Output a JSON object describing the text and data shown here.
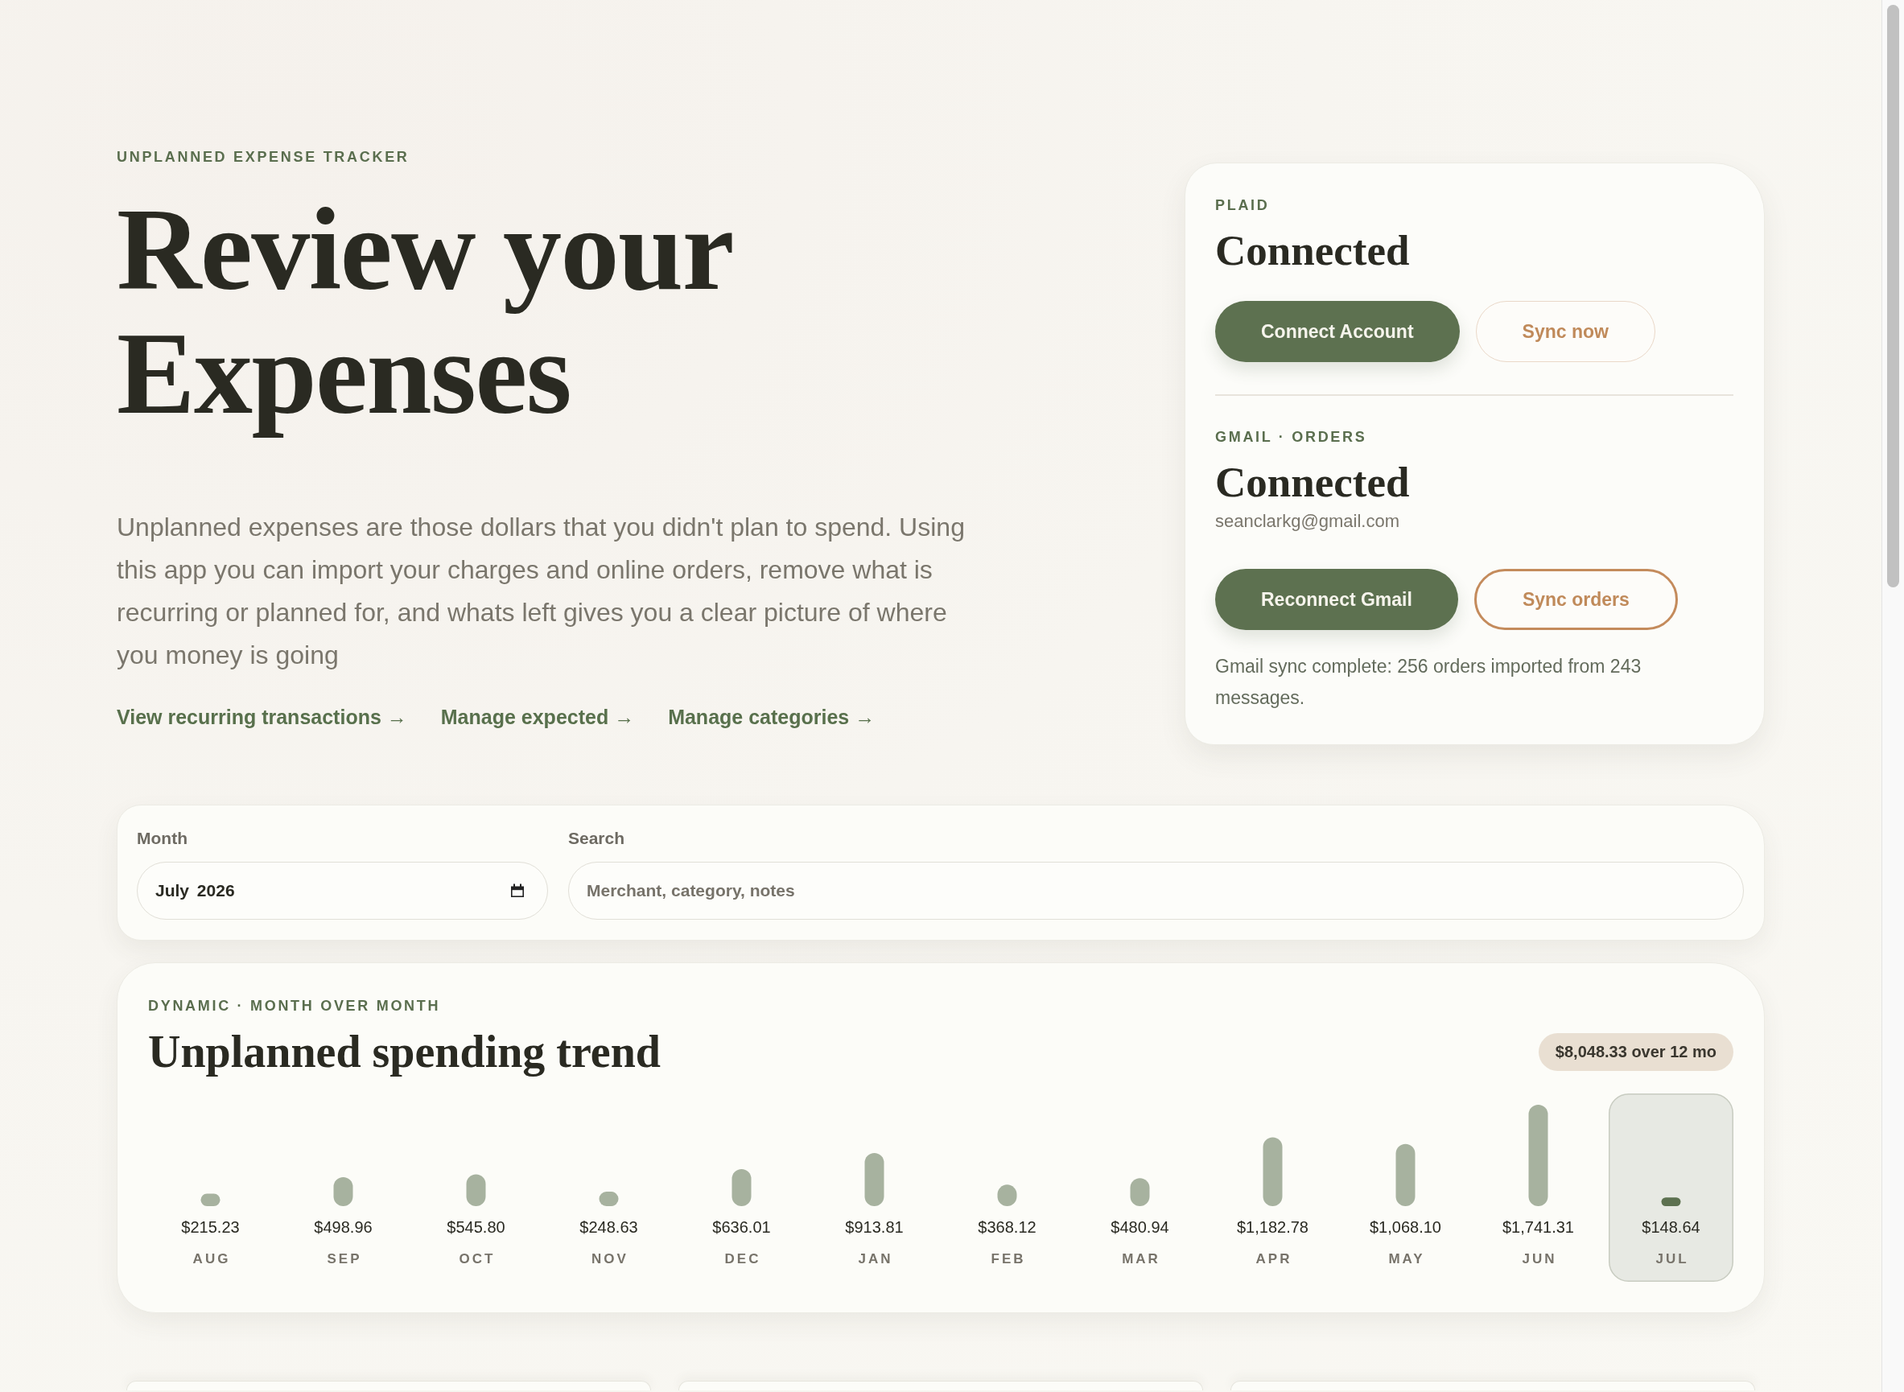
{
  "header": {
    "eyebrow": "UNPLANNED EXPENSE TRACKER",
    "title": "Review your Expenses",
    "intro": "Unplanned expenses are those dollars that you didn't plan to spend. Using this app you can import your charges and online orders, remove what is recurring or planned for, and whats left gives you a clear picture of where you money is going",
    "links": [
      {
        "label": "View recurring transactions →"
      },
      {
        "label": "Manage expected →"
      },
      {
        "label": "Manage categories →"
      }
    ]
  },
  "connections": [
    {
      "source": "PLAID",
      "status": "Connected",
      "buttons": [
        {
          "label": "Connect Account",
          "kind": "primary"
        },
        {
          "label": "Sync now",
          "kind": "ghost"
        }
      ]
    },
    {
      "source": "GMAIL · ORDERS",
      "status": "Connected",
      "account": "seanclarkg@gmail.com",
      "buttons": [
        {
          "label": "Reconnect Gmail",
          "kind": "primary"
        },
        {
          "label": "Sync orders",
          "kind": "outline"
        }
      ],
      "message": "Gmail sync complete: 256 orders imported from 243 messages."
    }
  ],
  "filters": {
    "month": {
      "label": "Month",
      "value": "July 2026"
    },
    "search": {
      "label": "Search",
      "placeholder": "Merchant, category, notes"
    }
  },
  "trend": {
    "eyebrow": "DYNAMIC · MONTH OVER MONTH",
    "title": "Unplanned spending trend",
    "total": "$8,048.33 over 12 mo",
    "month_columns": [
      {
        "selected": false
      },
      {
        "selected": false
      },
      {
        "selected": false
      },
      {
        "selected": false
      },
      {
        "selected": false
      },
      {
        "selected": false
      },
      {
        "selected": false
      },
      {
        "selected": false
      },
      {
        "selected": false
      },
      {
        "selected": false
      },
      {
        "selected": false
      },
      {
        "selected": true
      }
    ],
    "chart_data": {
      "type": "bar",
      "categories": [
        "AUG",
        "SEP",
        "OCT",
        "NOV",
        "DEC",
        "JAN",
        "FEB",
        "MAR",
        "APR",
        "MAY",
        "JUN",
        "JUL"
      ],
      "values": [
        215.23,
        498.96,
        545.8,
        248.63,
        636.01,
        913.81,
        368.12,
        480.94,
        1182.78,
        1068.1,
        1741.31,
        148.64
      ],
      "value_labels": [
        "$215.23",
        "$498.96",
        "$545.80",
        "$248.63",
        "$636.01",
        "$913.81",
        "$368.12",
        "$480.94",
        "$1,182.78",
        "$1,068.10",
        "$1,741.31",
        "$148.64"
      ]
    }
  }
}
